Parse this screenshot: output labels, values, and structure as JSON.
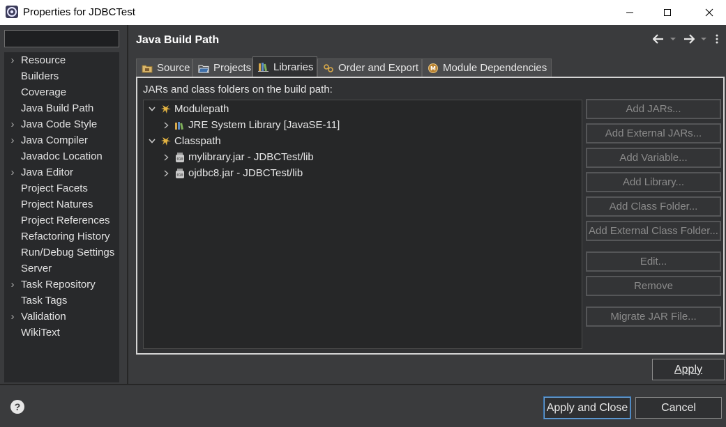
{
  "window": {
    "title": "Properties for JDBCTest",
    "minimize_glyph": "—",
    "maximize_glyph": "☐",
    "close_glyph": "✕"
  },
  "sidebar": {
    "filter_value": "",
    "items": [
      {
        "label": "Resource",
        "expandable": true
      },
      {
        "label": "Builders",
        "expandable": false
      },
      {
        "label": "Coverage",
        "expandable": false
      },
      {
        "label": "Java Build Path",
        "expandable": false
      },
      {
        "label": "Java Code Style",
        "expandable": true
      },
      {
        "label": "Java Compiler",
        "expandable": true
      },
      {
        "label": "Javadoc Location",
        "expandable": false
      },
      {
        "label": "Java Editor",
        "expandable": true
      },
      {
        "label": "Project Facets",
        "expandable": false
      },
      {
        "label": "Project Natures",
        "expandable": false
      },
      {
        "label": "Project References",
        "expandable": false
      },
      {
        "label": "Refactoring History",
        "expandable": false
      },
      {
        "label": "Run/Debug Settings",
        "expandable": false
      },
      {
        "label": "Server",
        "expandable": false
      },
      {
        "label": "Task Repository",
        "expandable": true
      },
      {
        "label": "Task Tags",
        "expandable": false
      },
      {
        "label": "Validation",
        "expandable": true
      },
      {
        "label": "WikiText",
        "expandable": false
      }
    ]
  },
  "page": {
    "title": "Java Build Path",
    "tabs": [
      {
        "label": "Source",
        "icon": "source-folder-icon"
      },
      {
        "label": "Projects",
        "icon": "projects-folder-icon"
      },
      {
        "label": "Libraries",
        "icon": "libraries-icon",
        "active": true
      },
      {
        "label": "Order and Export",
        "icon": "order-export-icon"
      },
      {
        "label": "Module Dependencies",
        "icon": "module-icon"
      }
    ],
    "build_path_label": "JARs and class folders on the build path:",
    "tree": {
      "modulepath": "Modulepath",
      "jre": "JRE System Library [JavaSE-11]",
      "classpath": "Classpath",
      "jar1": "mylibrary.jar - JDBCTest/lib",
      "jar2": "ojdbc8.jar - JDBCTest/lib"
    },
    "side_buttons": {
      "add_jars": "Add JARs...",
      "add_external_jars": "Add External JARs...",
      "add_variable": "Add Variable...",
      "add_library": "Add Library...",
      "add_class_folder": "Add Class Folder...",
      "add_external_class_folder": "Add External Class Folder...",
      "edit": "Edit...",
      "remove": "Remove",
      "migrate_jar": "Migrate JAR File..."
    },
    "apply": "Apply"
  },
  "footer": {
    "help": "?",
    "apply_and_close": "Apply and Close",
    "cancel": "Cancel"
  },
  "colors": {
    "background": "#3a3b3d",
    "tree_bg": "#262728",
    "focus_border": "#6aa2d8",
    "jar_icon": "#c9c9c9",
    "library_icon": "#d8a94a"
  }
}
